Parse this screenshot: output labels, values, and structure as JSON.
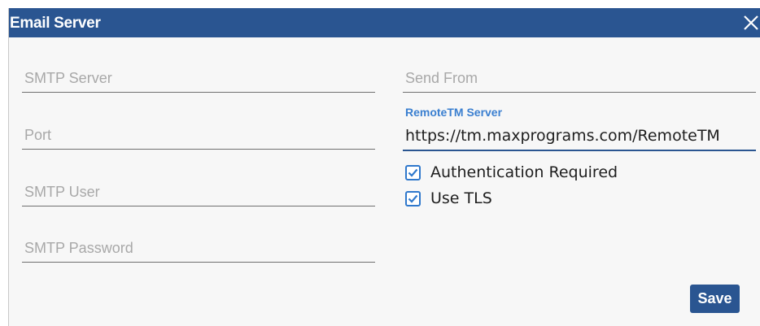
{
  "dialog": {
    "title": "Email Server",
    "close_icon": "close-icon"
  },
  "left_fields": {
    "smtp_server": {
      "placeholder": "SMTP Server",
      "value": ""
    },
    "port": {
      "placeholder": "Port",
      "value": ""
    },
    "smtp_user": {
      "placeholder": "SMTP User",
      "value": ""
    },
    "smtp_password": {
      "placeholder": "SMTP Password",
      "value": ""
    }
  },
  "right_fields": {
    "send_from": {
      "placeholder": "Send From",
      "value": ""
    },
    "remotetm_server": {
      "label": "RemoteTM Server",
      "value": "https://tm.maxprograms.com/RemoteTM"
    }
  },
  "options": {
    "authentication_required": {
      "label": "Authentication Required",
      "checked": true
    },
    "use_tls": {
      "label": "Use TLS",
      "checked": true
    }
  },
  "actions": {
    "save_label": "Save"
  },
  "colors": {
    "titlebar": "#2a5591",
    "accent": "#3a7fd0",
    "checkbox": "#2f78cc"
  }
}
